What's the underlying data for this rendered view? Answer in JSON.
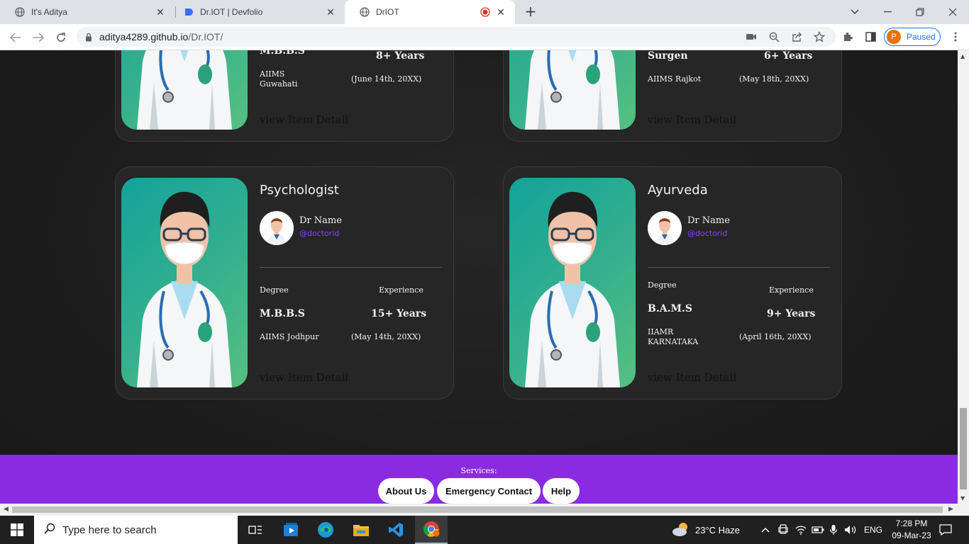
{
  "browser": {
    "tabs": [
      {
        "title": "It's Aditya",
        "close": "✕"
      },
      {
        "title": "Dr.IOT | Devfolio",
        "close": "✕"
      },
      {
        "title": "DrIOT",
        "close": "✕"
      }
    ],
    "new_tab": "+",
    "url_host": "aditya4289.github.io",
    "url_path": "/Dr.IOT/",
    "profile_initial": "P",
    "profile_status": "Paused"
  },
  "cards": [
    {
      "specialty": "",
      "degree_label": "",
      "experience_label": "",
      "degree": "M.B.B.S",
      "experience": "8+ Years",
      "college": "AIIMS Guwahati",
      "date": "(June 14th, 20XX)",
      "detail": "view Item Detail"
    },
    {
      "specialty": "",
      "degree_label": "",
      "experience_label": "",
      "degree": "Surgen",
      "experience": "6+ Years",
      "college": "AIIMS Rajkot",
      "date": "(May 18th, 20XX)",
      "detail": "view Item Detail"
    },
    {
      "specialty": "Psychologist",
      "doctor_name": "Dr Name",
      "doctor_id": "@doctorid",
      "degree_label": "Degree",
      "experience_label": "Experience",
      "degree": "M.B.B.S",
      "experience": "15+ Years",
      "college": "AIIMS Jodhpur",
      "date": "(May 14th, 20XX)",
      "detail": "view Item Detail"
    },
    {
      "specialty": "Ayurveda",
      "doctor_name": "Dr Name",
      "doctor_id": "@doctorid",
      "degree_label": "Degree",
      "experience_label": "Experience",
      "degree": "B.A.M.S",
      "experience": "9+ Years",
      "college": "IIAMR KARNATAKA",
      "date": "(April 16th, 20XX)",
      "detail": "view Item Detail"
    }
  ],
  "footer": {
    "services_label": "Services:",
    "buttons": [
      "About Us",
      "Emergency Contact",
      "Help"
    ]
  },
  "taskbar": {
    "search_placeholder": "Type here to search",
    "weather": "23°C  Haze",
    "language": "ENG",
    "time": "7:28 PM",
    "date": "09-Mar-23"
  },
  "colors": {
    "accent_purple": "#8a2be2",
    "doctor_id": "#8a3ffc",
    "card_bg": "#262626",
    "photo_gradient_start": "#12a39a",
    "photo_gradient_end": "#56c07f"
  }
}
